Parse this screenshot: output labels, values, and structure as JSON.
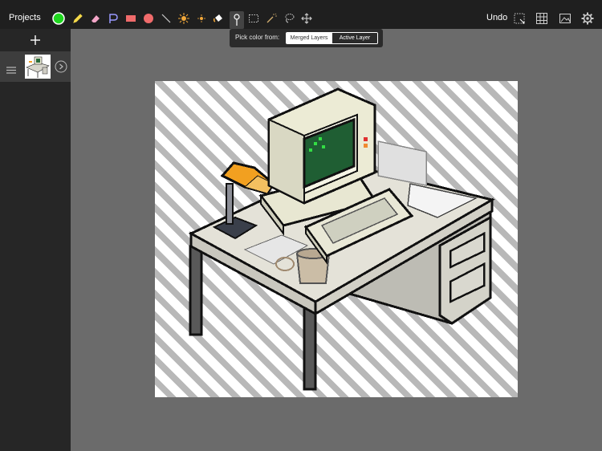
{
  "toolbar": {
    "projects_label": "Projects",
    "undo_label": "Undo",
    "current_color": "#1fd61f",
    "shape_color": "#f06b6b",
    "accent_color": "#f2a83a",
    "tools": [
      "color-swatch",
      "pencil",
      "eraser",
      "text",
      "rectangle",
      "ellipse",
      "line",
      "brush-large",
      "brush-small",
      "fill",
      "eyedropper",
      "rect-select",
      "magic-wand",
      "lasso",
      "move"
    ],
    "right_tools": [
      "transform-selection",
      "grid",
      "image",
      "settings"
    ]
  },
  "picker_popup": {
    "label": "Pick color from:",
    "options": [
      "Merged Layers",
      "Active Layer"
    ],
    "selected": "Merged Layers"
  },
  "layers": {
    "add_icon": "plus-icon",
    "items": [
      {
        "thumbnail": "desk-computer-thumbnail",
        "selected": true
      }
    ]
  },
  "canvas": {
    "background": "transparency-stripes",
    "artwork": "pixel-art-desk-with-computer"
  }
}
